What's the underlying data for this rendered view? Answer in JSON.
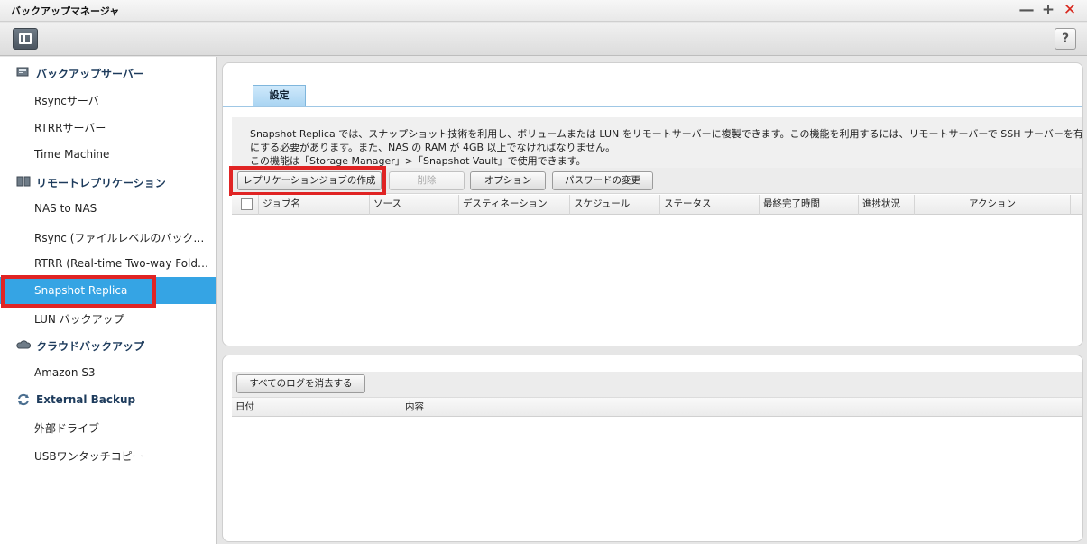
{
  "window": {
    "title": "バックアップマネージャ"
  },
  "window_controls": {
    "minimize": "—",
    "maximize": "+",
    "close": "✕"
  },
  "toolbar": {
    "help": "?"
  },
  "sidebar": {
    "groups": [
      {
        "label": "バックアップサーバー",
        "icon": "server-icon",
        "items": [
          "Rsyncサーバ",
          "RTRRサーバー",
          "Time Machine"
        ]
      },
      {
        "label": "リモートレプリケーション",
        "icon": "replication-icon",
        "items": [
          "NAS to NAS",
          "Rsync (ファイルレベルのバックアップ)",
          "RTRR (Real-time Two-way Folder Sync)",
          "Snapshot Replica",
          "LUN バックアップ"
        ]
      },
      {
        "label": "クラウドバックアップ",
        "icon": "cloud-icon",
        "items": [
          "Amazon S3"
        ]
      },
      {
        "label": "External Backup",
        "icon": "sync-icon",
        "items": [
          "外部ドライブ",
          "USBワンタッチコピー"
        ]
      }
    ],
    "active_item": "Snapshot Replica"
  },
  "main": {
    "tab": "設定",
    "description": [
      "Snapshot Replica では、スナップショット技術を利用し、ボリュームまたは LUN をリモートサーバーに複製できます。この機能を利用するには、リモートサーバーで SSH サーバーを有",
      "にする必要があります。また、NAS の RAM が 4GB 以上でなければなりません。",
      "この機能は「Storage Manager」>「Snapshot Vault」で使用できます。"
    ],
    "buttons": {
      "create_job": "レプリケーションジョブの作成",
      "delete": "削除",
      "options": "オプション",
      "change_password": "パスワードの変更"
    },
    "columns": [
      "ジョブ名",
      "ソース",
      "デスティネーション",
      "スケジュール",
      "ステータス",
      "最終完了時間",
      "進捗状況",
      "アクション"
    ]
  },
  "log": {
    "clear_button": "すべてのログを消去する",
    "columns": [
      "日付",
      "内容"
    ]
  },
  "colors": {
    "active": "#35a4e4",
    "highlight": "#e02424"
  }
}
